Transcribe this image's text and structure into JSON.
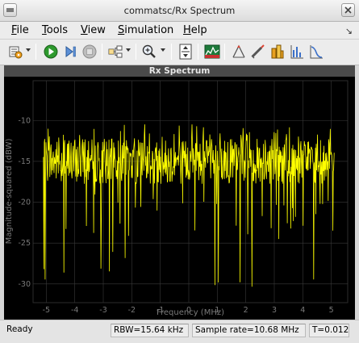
{
  "window": {
    "title": "commatsc/Rx Spectrum"
  },
  "menu": {
    "items": [
      {
        "mnemonic": "F",
        "rest": "ile"
      },
      {
        "mnemonic": "T",
        "rest": "ools"
      },
      {
        "mnemonic": "V",
        "rest": "iew"
      },
      {
        "mnemonic": "S",
        "rest": "imulation"
      },
      {
        "mnemonic": "H",
        "rest": "elp"
      }
    ],
    "overflow_glyph": "↘"
  },
  "toolbar": {
    "icons": [
      "parameters-icon",
      "run-icon",
      "step-forward-icon",
      "stop-icon",
      "highlight-model-icon",
      "zoom-in-icon",
      "autoscale-icon",
      "spectrum-settings-icon",
      "peak-finder-icon",
      "cursor-measurements-icon",
      "channel-measurements-icon",
      "distortion-measurements-icon",
      "ccdf-measurements-icon"
    ]
  },
  "colors": {
    "trace": "#ffff00",
    "axes_background": "#000000",
    "axis_text": "#7a7a7a",
    "grid": "#3a3a3a"
  },
  "chart_data": {
    "type": "line",
    "title": "Rx Spectrum",
    "xlabel": "Frequency (MHz)",
    "ylabel": "Magnitude-squared (dBW)",
    "xlim": [
      -5.35,
      5.35
    ],
    "ylim": [
      -31.5,
      -8
    ],
    "xticks": [
      -5,
      -4,
      -3,
      -2,
      -1,
      0,
      1,
      2,
      3,
      4,
      5
    ],
    "yticks": [
      -10,
      -15,
      -20,
      -25,
      -30
    ],
    "grid": true,
    "series": [
      {
        "color": "#ffff00",
        "points": 684,
        "band_top_dbw": -12.5,
        "band_center_dbw": -15,
        "lowest_dips_dbw": [
          -27.5,
          -29.5,
          -30.5
        ]
      }
    ]
  },
  "status": {
    "state": "Ready",
    "rbw": "RBW=15.64 kHz",
    "sample_rate": "Sample rate=10.68 MHz",
    "time": "T=0.012"
  }
}
